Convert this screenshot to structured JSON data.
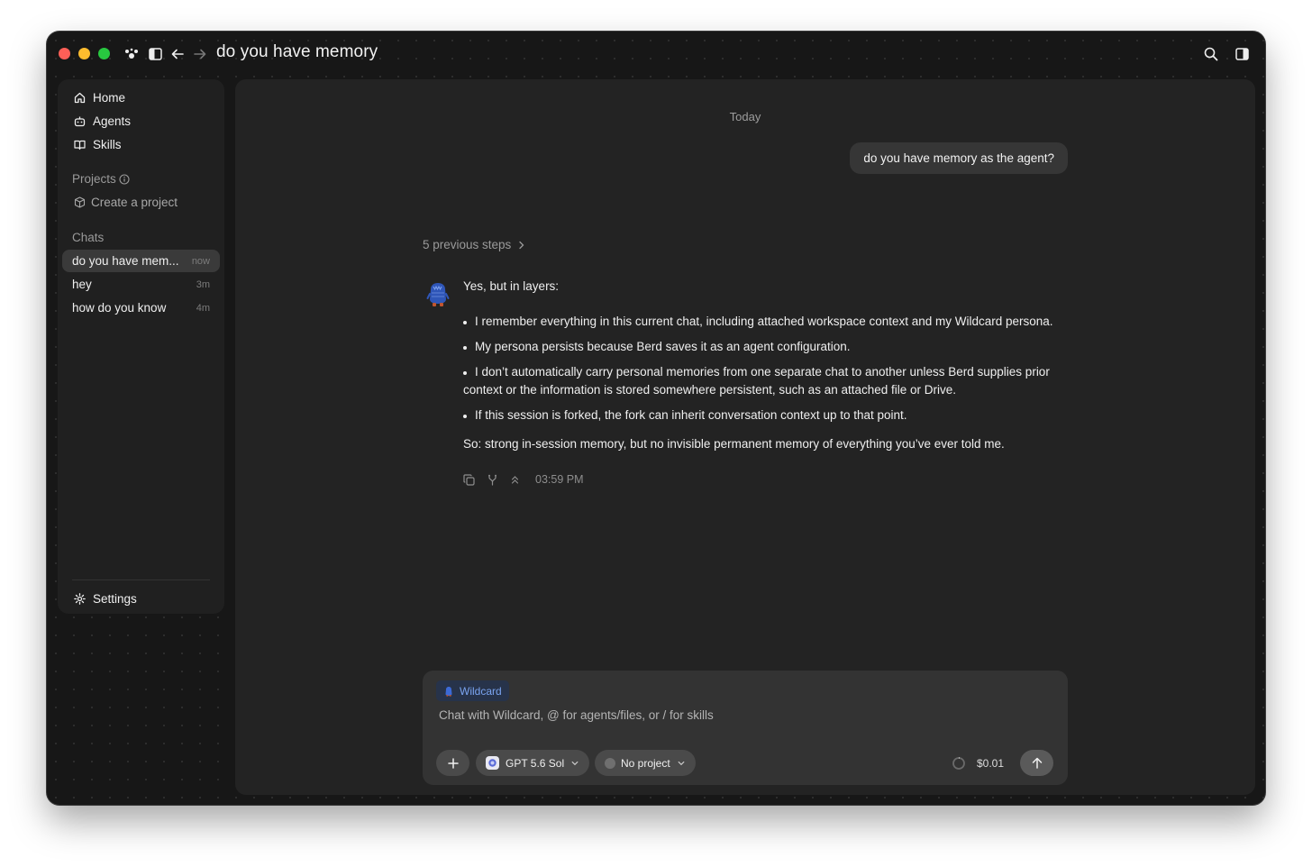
{
  "window": {
    "title": "do you have memory"
  },
  "titlebar_icons": [
    "app-logo-icon",
    "sidebar-toggle-icon",
    "back-arrow-icon",
    "forward-arrow-icon",
    "search-icon",
    "right-panel-icon"
  ],
  "sidebar": {
    "nav": [
      {
        "label": "Home",
        "icon": "home-icon"
      },
      {
        "label": "Agents",
        "icon": "robot-icon"
      },
      {
        "label": "Skills",
        "icon": "book-icon"
      }
    ],
    "projects_label": "Projects",
    "create_project_label": "Create a project",
    "chats_label": "Chats",
    "chats": [
      {
        "title": "do you have mem...",
        "time": "now",
        "active": true
      },
      {
        "title": "hey",
        "time": "3m",
        "active": false
      },
      {
        "title": "how do you know",
        "time": "4m",
        "active": false
      }
    ],
    "settings_label": "Settings"
  },
  "conversation": {
    "day_label": "Today",
    "user_message": "do you have memory as the agent?",
    "previous_steps": "5 previous steps",
    "reply": {
      "intro": "Yes, but in layers:",
      "bullets": [
        "I remember everything in this current chat, including attached workspace context and my Wildcard persona.",
        "My persona persists because Berd saves it as an agent configuration.",
        "I don’t automatically carry personal memories from one separate chat to another unless Berd supplies prior context or the information is stored somewhere persistent, such as an attached file or Drive.",
        "If this session is forked, the fork can inherit conversation context up to that point."
      ],
      "closing": "So: strong in-session memory, but no invisible permanent memory of everything you’ve ever told me.",
      "timestamp": "03:59 PM"
    }
  },
  "composer": {
    "agent_chip": "Wildcard",
    "placeholder": "Chat with Wildcard, @ for agents/files, or / for skills",
    "model": "GPT 5.6 Sol",
    "project": "No project",
    "cost": "$0.01"
  },
  "colors": {
    "window_bg": "#171717",
    "sidebar_bg": "#202020",
    "main_bg": "#232323",
    "composer_bg": "#333333",
    "accent_blue": "#7aa4f0",
    "traffic_red": "#ff5f57",
    "traffic_yellow": "#febc2e",
    "traffic_green": "#28c840"
  }
}
